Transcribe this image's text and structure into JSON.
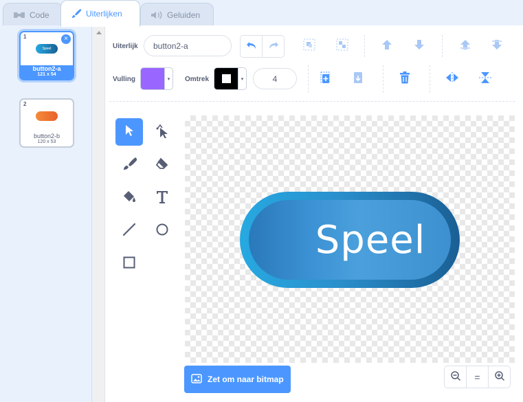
{
  "tabs": [
    {
      "label": "Code",
      "icon": "code-icon"
    },
    {
      "label": "Uiterlijken",
      "icon": "brush-icon"
    },
    {
      "label": "Geluiden",
      "icon": "speaker-icon"
    }
  ],
  "costumes": [
    {
      "number": "1",
      "name": "button2-a",
      "size": "121 x 54",
      "thumb_text": "Speel"
    },
    {
      "number": "2",
      "name": "button2-b",
      "size": "120 x 53"
    }
  ],
  "toolbar": {
    "costume_label": "Uiterlijk",
    "costume_name": "button2-a",
    "fill_label": "Vulling",
    "fill_color": "#9966ff",
    "outline_label": "Omtrek",
    "outline_color": "#000000",
    "outline_width": "4"
  },
  "canvas": {
    "button_text": "Speel"
  },
  "bitmap_button": "Zet om naar bitmap",
  "zoom": {
    "out": "−",
    "reset": "=",
    "in": "+"
  },
  "colors": {
    "accent": "#4c97ff",
    "text": "#575e75"
  }
}
